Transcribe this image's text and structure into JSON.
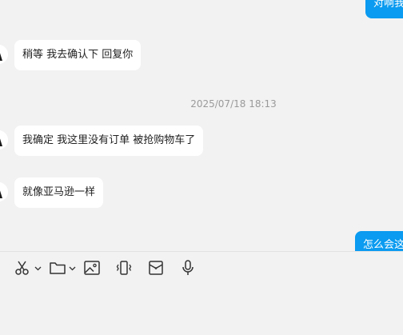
{
  "messages": {
    "out_top": "对啊我",
    "in_1": "稍等  我去确认下 回复你",
    "timestamp": "2025/07/18 18:13",
    "in_2": "我确定 我这里没有订单  被抢购物车了",
    "in_3": "就像亚马逊一样",
    "out_bottom": "怎么会这"
  },
  "toolbar": {
    "icons": [
      "scissors-icon",
      "folder-icon",
      "image-icon",
      "vibrate-icon",
      "red-packet-icon",
      "microphone-icon"
    ]
  },
  "colors": {
    "background": "#f2f2f2",
    "incoming_bubble": "#ffffff",
    "outgoing_bubble": "#0b9bf0"
  }
}
